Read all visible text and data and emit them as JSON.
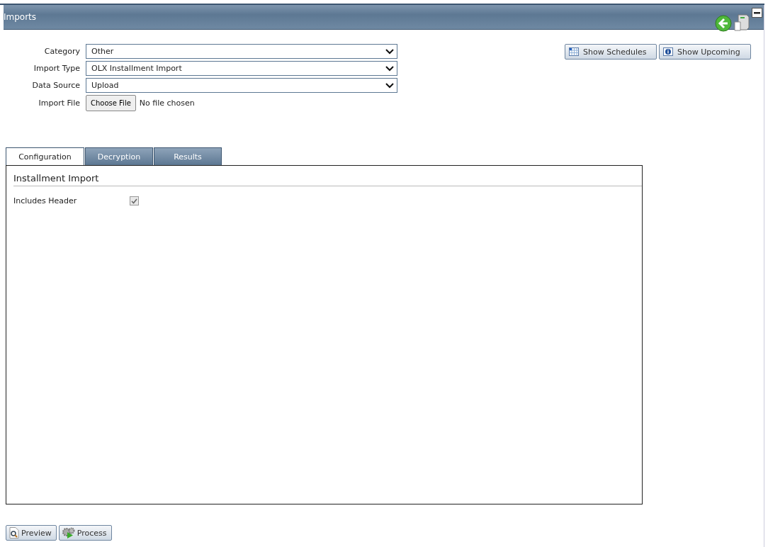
{
  "window": {
    "title": "Imports"
  },
  "form": [
    {
      "kind": "select",
      "label": "Category",
      "value": "Other"
    },
    {
      "kind": "select",
      "label": "Import Type",
      "value": "OLX Installment Import"
    },
    {
      "kind": "select",
      "label": "Data Source",
      "value": "Upload"
    },
    {
      "kind": "file",
      "label": "Import File",
      "button": "Choose File",
      "status": "No file chosen"
    }
  ],
  "actions": [
    {
      "kind": "calendar",
      "label": "Show Schedules"
    },
    {
      "kind": "info",
      "label": "Show Upcoming"
    }
  ],
  "tabs": [
    {
      "label": "Configuration",
      "selected": true
    },
    {
      "label": "Decryption",
      "selected": false
    },
    {
      "label": "Results",
      "selected": false
    }
  ],
  "panel": {
    "title": "Installment Import",
    "options": [
      {
        "label": "Includes Header",
        "checked": true
      }
    ]
  },
  "footer_buttons": [
    {
      "kind": "preview",
      "label": "Preview"
    },
    {
      "kind": "process",
      "label": "Process"
    }
  ]
}
